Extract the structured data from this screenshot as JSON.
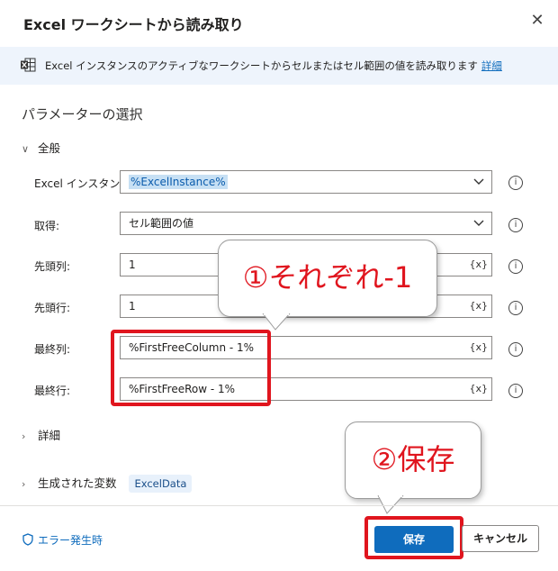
{
  "dialog": {
    "title": "Excel ワークシートから読み取り",
    "close_glyph": "✕"
  },
  "infobar": {
    "text": "Excel インスタンスのアクティブなワークシートからセルまたはセル範囲の値を読み取ります",
    "link": "詳細",
    "icon": "excel-icon"
  },
  "section": {
    "title": "パラメーターの選択"
  },
  "general": {
    "header": "全般",
    "chevron": "∨",
    "rows": [
      {
        "label": "Excel インスタンス:",
        "value": "%ExcelInstance%",
        "kind": "dropdown"
      },
      {
        "label": "取得:",
        "value": "セル範囲の値",
        "kind": "dropdown"
      },
      {
        "label": "先頭列:",
        "value": "1",
        "kind": "text"
      },
      {
        "label": "先頭行:",
        "value": "1",
        "kind": "text"
      },
      {
        "label": "最終列:",
        "value": "%FirstFreeColumn - 1%",
        "kind": "text"
      },
      {
        "label": "最終行:",
        "value": "%FirstFreeRow - 1%",
        "kind": "text"
      }
    ],
    "var_button": "{x}",
    "help_glyph": "i"
  },
  "advanced": {
    "header": "詳細",
    "chevron": "›"
  },
  "generated": {
    "header": "生成された変数",
    "chevron": "›",
    "variable": "ExcelData"
  },
  "callouts": {
    "first": "①それぞれ-1",
    "second": "②保存"
  },
  "footer": {
    "error_link": "エラー発生時",
    "save": "保存",
    "cancel": "キャンセル"
  },
  "colors": {
    "accent": "#0f6cbd",
    "annotation_red": "#e0151e",
    "info_bg": "#eef4fc"
  }
}
